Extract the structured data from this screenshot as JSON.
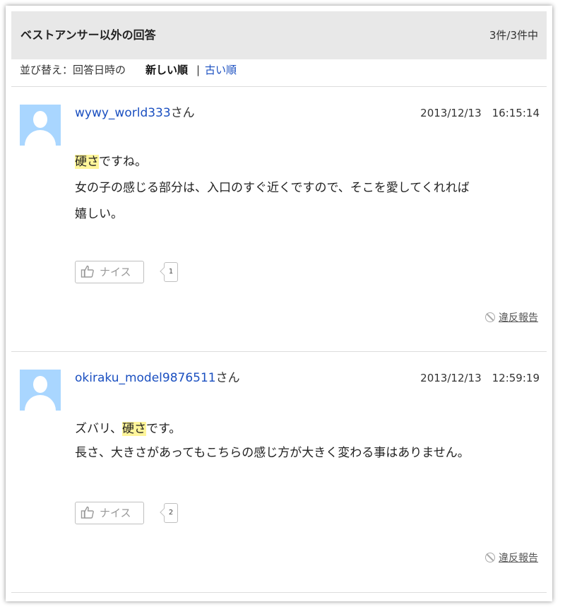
{
  "header": {
    "title": "ベストアンサー以外の回答",
    "count": "3件/3件中"
  },
  "sort": {
    "label": "並び替え：回答日時の",
    "active": "新しい順",
    "separator": "|",
    "other": "古い順"
  },
  "answers": [
    {
      "username": "wywy_world333",
      "suffix": "さん",
      "datetime": "2013/12/13　16:15:14",
      "line1_highlight": "硬さ",
      "line1_rest": "ですね。",
      "line2": "女の子の感じる部分は、入口のすぐ近くですので、そこを愛してくれれば",
      "line3": "嬉しい。",
      "nice_label": "ナイス",
      "nice_count": "1",
      "report": "違反報告"
    },
    {
      "username": "okiraku_model9876511",
      "suffix": "さん",
      "datetime": "2013/12/13　12:59:19",
      "line1_pre": "ズバリ、",
      "line1_highlight": "硬さ",
      "line1_rest": "です。",
      "line2": "長さ、大きさがあってもこちらの感じ方が大きく変わる事はありません。",
      "nice_label": "ナイス",
      "nice_count": "2",
      "report": "違反報告"
    }
  ],
  "icons": {
    "thumb": "thumbs-up-icon",
    "report": "prohibited-icon",
    "avatar": "default-user-avatar"
  },
  "colors": {
    "link": "#1a4fc0",
    "highlight": "#fff59a",
    "header_bg": "#e8e8e8",
    "avatar_bg": "#a9d6ff"
  }
}
